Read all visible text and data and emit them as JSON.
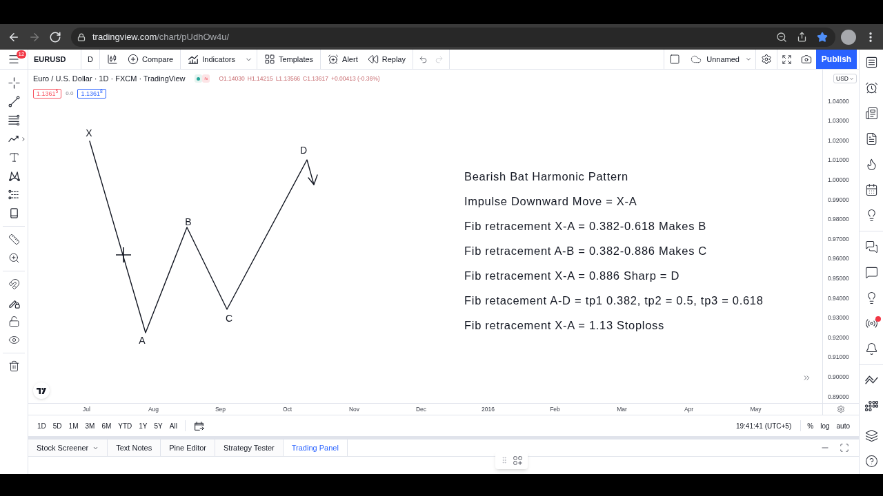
{
  "browser": {
    "nav": [
      {
        "kind": "back",
        "disabled": false
      },
      {
        "kind": "forward",
        "disabled": true
      },
      {
        "kind": "reload",
        "disabled": false
      }
    ],
    "url": {
      "host": "tradingview.com",
      "path": "/chart/pUdhOw4u/"
    },
    "actions": [
      {
        "kind": "zoom"
      },
      {
        "kind": "share"
      },
      {
        "kind": "bookmark",
        "on": true
      },
      {
        "kind": "profile"
      },
      {
        "kind": "menu"
      }
    ]
  },
  "header": {
    "menu_badge": "12",
    "symbol": "EURUSD",
    "interval": "D",
    "tool_groups": [
      {
        "tools": [
          {
            "kind": "chart_style"
          },
          {
            "kind": "compare",
            "label": "Compare"
          }
        ]
      },
      {
        "tools": [
          {
            "kind": "indicators",
            "label": "Indicators"
          }
        ]
      },
      {
        "tools": [
          {
            "kind": "templates",
            "label": "Templates"
          }
        ]
      },
      {
        "tools": [
          {
            "kind": "alert",
            "label": "Alert"
          },
          {
            "kind": "replay",
            "label": "Replay"
          }
        ]
      }
    ],
    "history": [
      {
        "kind": "undo",
        "disabled": false
      },
      {
        "kind": "redo",
        "disabled": true
      }
    ],
    "layout_name": "Unnamed",
    "publish": "Publish"
  },
  "left_toolbar": {
    "groups": [
      {
        "tools": [
          {
            "kind": "crosshair"
          },
          {
            "kind": "trend_line"
          },
          {
            "kind": "fib"
          },
          {
            "kind": "patterns"
          },
          {
            "kind": "text"
          },
          {
            "kind": "xabcd"
          },
          {
            "kind": "forecast"
          },
          {
            "kind": "shape"
          }
        ]
      },
      {
        "tools": [
          {
            "kind": "measure"
          },
          {
            "kind": "zoom"
          }
        ]
      },
      {
        "tools": [
          {
            "kind": "magnet"
          },
          {
            "kind": "lock_drawing"
          },
          {
            "kind": "lock"
          },
          {
            "kind": "hide"
          }
        ]
      },
      {
        "tools": [
          {
            "kind": "remove"
          }
        ]
      }
    ]
  },
  "chart": {
    "legend": {
      "title": "Euro / U.S. Dollar · 1D · FXCM · TradingView",
      "badge": "≈",
      "ohlc": [
        "O1.14030",
        "H1.14215",
        "L1.13566",
        "C1.13617",
        "+0.00413 (-0.36%)"
      ]
    },
    "quote": {
      "sell": "1.1361$^{5}$",
      "spread": "0.0",
      "buy": "1.1361$^{8}$"
    },
    "pattern_labels": [
      "X",
      "A",
      "B",
      "C",
      "D"
    ],
    "text_note": [
      "Bearish Bat Harmonic Pattern",
      "Impulse Downward Move = X-A",
      "Fib retracement X-A = 0.382-0.618 Makes B",
      "Fib retracement A-B = 0.382-0.886 Makes C",
      "Fib retracement X-A = 0.886 Sharp = D",
      "Fib retacement A-D = tp1 0.382, tp2 = 0.5, tp3 = 0.618",
      "Fib retracement X-A = 1.13 Stoploss"
    ],
    "currency": "USD",
    "price_ticks": [
      "1.04000",
      "1.03000",
      "1.02000",
      "1.01000",
      "1.00000",
      "0.99000",
      "0.98000",
      "0.97000",
      "0.96000",
      "0.95000",
      "0.94000",
      "0.93000",
      "0.92000",
      "0.91000",
      "0.90000",
      "0.89000"
    ],
    "time_ticks": [
      "Jul",
      "Aug",
      "Sep",
      "Oct",
      "Nov",
      "Dec",
      "2016",
      "Feb",
      "Mar",
      "Apr",
      "May"
    ]
  },
  "range_bar": {
    "ranges": [
      "1D",
      "5D",
      "1M",
      "3M",
      "6M",
      "YTD",
      "1Y",
      "5Y",
      "All"
    ],
    "clock": "19:41:41 (UTC+5)",
    "scale_options": [
      "%",
      "log",
      "auto"
    ]
  },
  "bottom_panel": {
    "tabs": [
      {
        "label": "Stock Screener",
        "kind": "menu",
        "selected": false
      },
      {
        "label": "Text Notes",
        "kind": "tab",
        "selected": false
      },
      {
        "label": "Pine Editor",
        "kind": "tab",
        "selected": false
      },
      {
        "label": "Strategy Tester",
        "kind": "tab",
        "selected": false
      },
      {
        "label": "Trading Panel",
        "kind": "tab",
        "selected": true
      }
    ]
  },
  "right_sidebar": {
    "groups": [
      {
        "items": [
          {
            "kind": "watchlist",
            "notify": false
          },
          {
            "kind": "alerts",
            "notify": false
          },
          {
            "kind": "news",
            "notify": false
          },
          {
            "kind": "ideas",
            "notify": false
          },
          {
            "kind": "hotlist",
            "notify": false
          },
          {
            "kind": "calendar",
            "notify": false
          },
          {
            "kind": "idea",
            "notify": false
          }
        ]
      },
      {
        "items": [
          {
            "kind": "chats",
            "notify": false
          },
          {
            "kind": "chat",
            "notify": false
          },
          {
            "kind": "idea_stream",
            "notify": false
          },
          {
            "kind": "streams",
            "notify": true
          },
          {
            "kind": "notifications",
            "notify": false
          }
        ]
      },
      {
        "items": [
          {
            "kind": "orders",
            "notify": false
          },
          {
            "kind": "dom",
            "notify": false
          },
          {
            "kind": "layers",
            "notify": false
          },
          {
            "kind": "help",
            "notify": false
          }
        ]
      }
    ]
  }
}
